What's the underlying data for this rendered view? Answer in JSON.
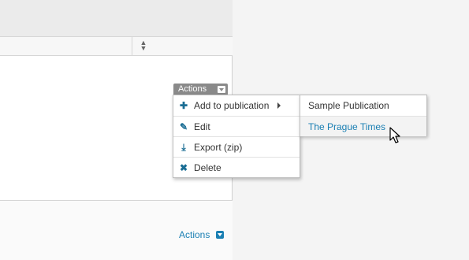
{
  "row_actions": {
    "label": "Actions"
  },
  "menu": {
    "items": [
      {
        "label": "Add to publication",
        "icon": "plus-icon"
      },
      {
        "label": "Edit",
        "icon": "pencil-icon"
      },
      {
        "label": "Export (zip)",
        "icon": "download-icon"
      },
      {
        "label": "Delete",
        "icon": "x-icon"
      }
    ]
  },
  "submenu": {
    "items": [
      {
        "label": "Sample Publication"
      },
      {
        "label": "The Prague Times"
      }
    ]
  },
  "footer_actions": {
    "label": "Actions"
  },
  "colors": {
    "link": "#1a7fb3",
    "icon": "#1a6d94",
    "button": "#8a8a8a"
  }
}
